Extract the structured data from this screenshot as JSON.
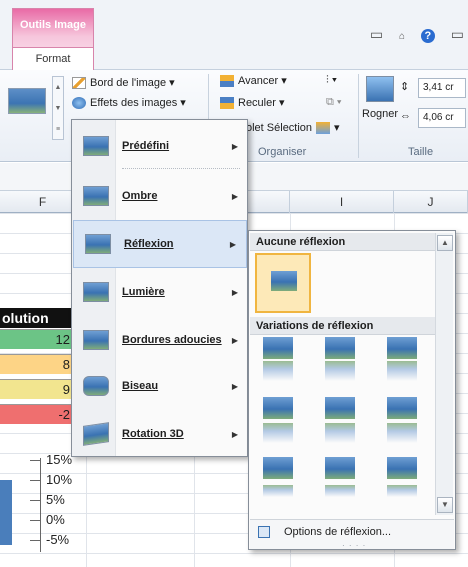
{
  "ribbon": {
    "context_tab": "Outils Image",
    "active_tab": "Format",
    "items": {
      "border": "Bord de l'image",
      "effects": "Effets des images",
      "forward": "Avancer",
      "backward": "Reculer",
      "selection_pane": "olet Sélection",
      "crop": "Rogner",
      "height": "3,41 cr",
      "width": "4,06 cr"
    },
    "groups": {
      "arrange": "Organiser",
      "size": "Taille"
    }
  },
  "sheet": {
    "columns": [
      "F",
      "I",
      "J"
    ],
    "evolution_header": "olution",
    "values": [
      "12",
      "8",
      "9",
      "-2"
    ],
    "value_colors": [
      "#6cc486",
      "#fdd486",
      "#f2e58f",
      "#ef6f6f"
    ],
    "chart_ticks": [
      "15%",
      "10%",
      "5%",
      "0%",
      "-5%"
    ]
  },
  "menu": {
    "items": [
      {
        "label": "Prédéfini"
      },
      {
        "label": "Ombre"
      },
      {
        "label": "Réflexion"
      },
      {
        "label": "Lumière"
      },
      {
        "label": "Bordures adoucies"
      },
      {
        "label": "Biseau"
      },
      {
        "label": "Rotation 3D"
      }
    ]
  },
  "submenu": {
    "none_header": "Aucune réflexion",
    "variations_header": "Variations de réflexion",
    "options": "Options de réflexion..."
  }
}
